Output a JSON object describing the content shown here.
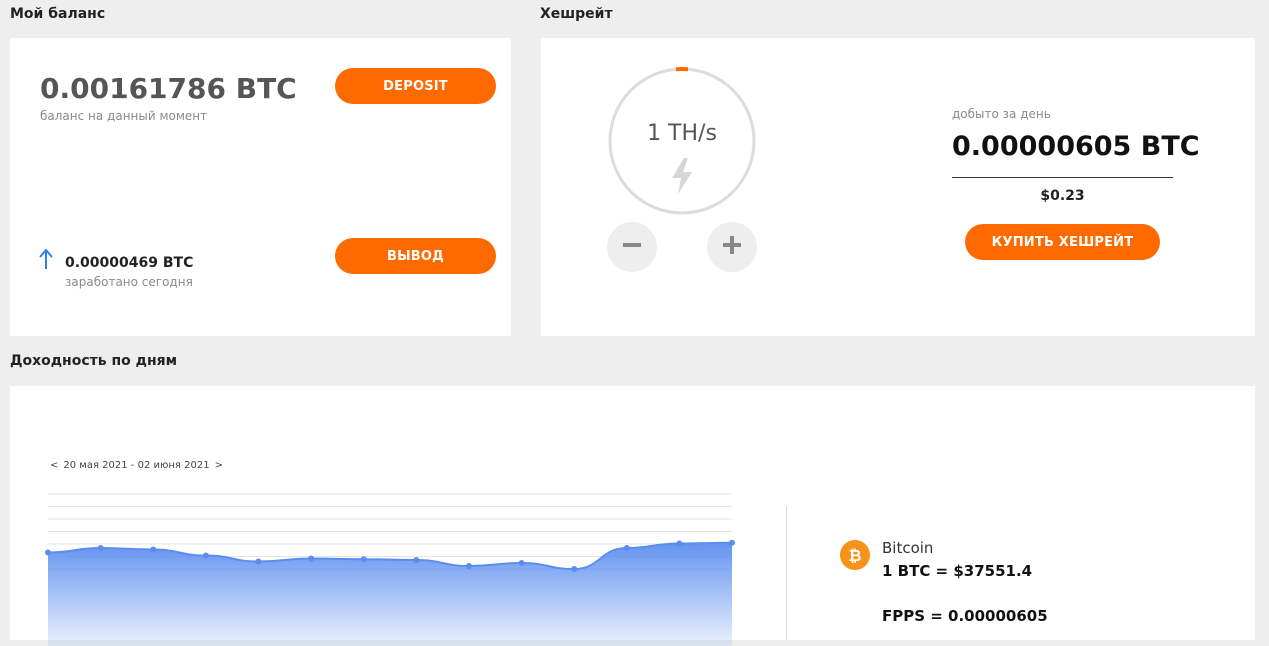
{
  "balance_section": {
    "title": "Мой баланс",
    "amount": "0.00161786 BTC",
    "amount_caption": "баланс на данный момент",
    "deposit_label": "DEPOSIT",
    "withdraw_label": "ВЫВОД",
    "earned_today_value": "0.00000469 BTC",
    "earned_today_caption": "заработано сегодня"
  },
  "hashrate_section": {
    "title": "Хешрейт",
    "gauge_value": "1 TH/s",
    "mined_caption": "добыто за день",
    "mined_value": "0.00000605 BTC",
    "mined_usd": "$0.23",
    "buy_label": "КУПИТЬ ХЕШРЕЙТ"
  },
  "profit_section": {
    "title": "Доходность по дням",
    "date_range": "20 мая 2021 - 02 июня 2021",
    "prev_arrow": "<",
    "next_arrow": ">",
    "coin_name": "Bitcoin",
    "coin_rate": "1 BTC = $37551.4",
    "fpps": "FPPS = 0.00000605"
  },
  "colors": {
    "accent": "#ff6a00",
    "chart_line": "#5b8def",
    "bitcoin": "#f7931a"
  },
  "icons": [
    "arrow-up-icon",
    "lightning-icon",
    "minus-icon",
    "plus-icon",
    "bitcoin-icon",
    "chevron-left-icon",
    "chevron-right-icon"
  ],
  "chart_data": {
    "type": "area",
    "x": [
      1,
      2,
      3,
      4,
      5,
      6,
      7,
      8,
      9,
      10,
      11,
      12,
      13,
      14
    ],
    "values": [
      6.1,
      6.4,
      6.3,
      5.9,
      5.5,
      5.7,
      5.65,
      5.6,
      5.2,
      5.4,
      5.0,
      6.4,
      6.7,
      6.75
    ],
    "ylim": [
      0,
      10
    ],
    "grid": true,
    "xlabel": "",
    "ylabel": ""
  }
}
